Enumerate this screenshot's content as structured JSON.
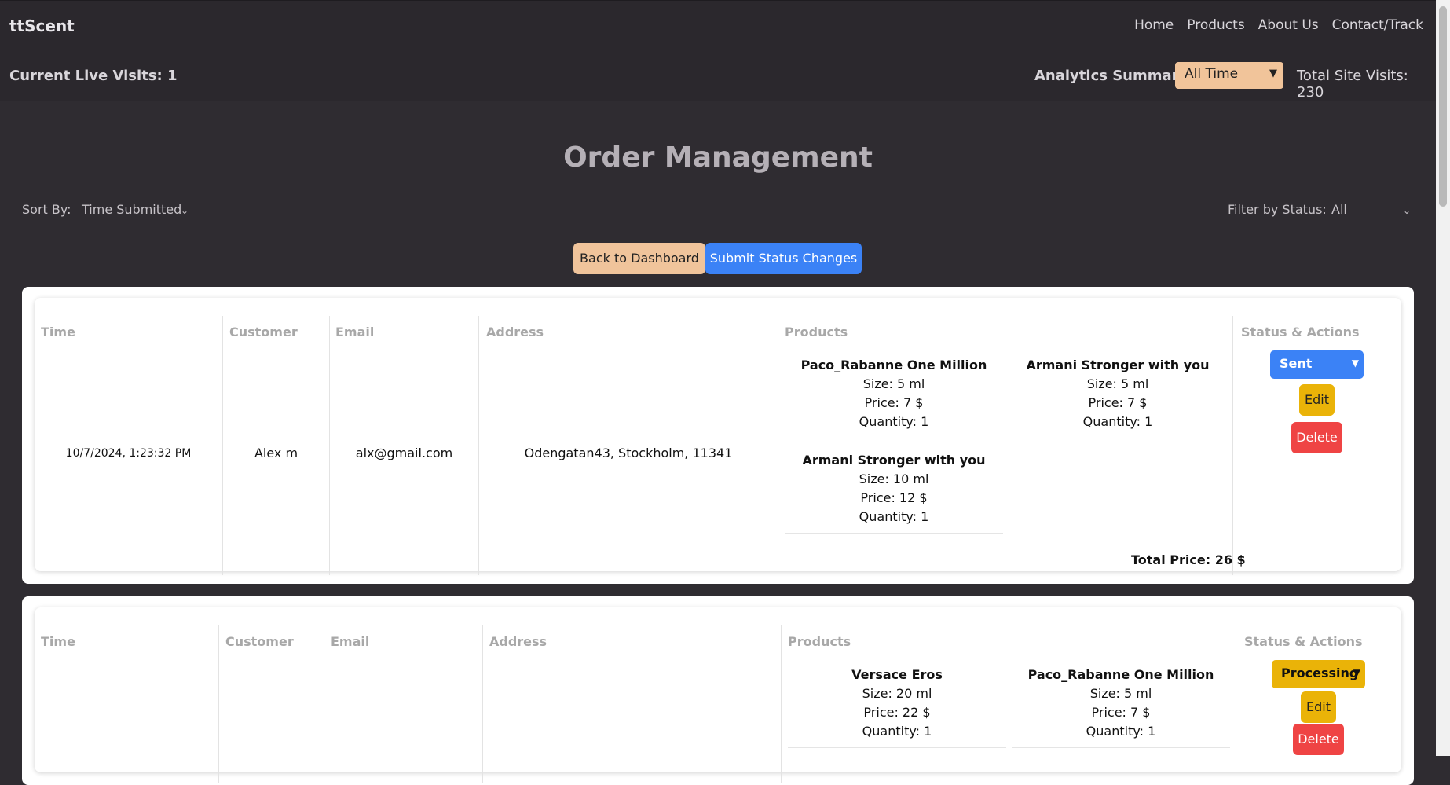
{
  "header": {
    "brand": "ttScent",
    "nav": [
      "Home",
      "Products",
      "About Us",
      "Contact/Track"
    ],
    "live_visits": "Current Live Visits: 1",
    "analytics_label": "Analytics Summary",
    "range_selected": "All Time",
    "total_visits": "Total Site Visits: 230"
  },
  "page": {
    "title": "Order Management",
    "sort_label": "Sort By:",
    "sort_value": "Time Submitted",
    "filter_label": "Filter by Status:",
    "filter_value": "All",
    "back_button": "Back to Dashboard",
    "submit_button": "Submit Status Changes"
  },
  "columns": [
    "Time",
    "Customer",
    "Email",
    "Address",
    "Products",
    "Status & Actions"
  ],
  "orders": [
    {
      "time": "10/7/2024, 1:23:32 PM",
      "customer": "Alex m",
      "email": "alx@gmail.com",
      "address": "Odengatan43, Stockholm, 11341",
      "products": [
        {
          "name": "Paco_Rabanne One Million",
          "size": "Size: 5 ml",
          "price": "Price: 7 $",
          "quantity": "Quantity: 1"
        },
        {
          "name": "Armani Stronger with you",
          "size": "Size: 5 ml",
          "price": "Price: 7 $",
          "quantity": "Quantity: 1"
        },
        {
          "name": "Armani Stronger with you",
          "size": "Size: 10 ml",
          "price": "Price: 12 $",
          "quantity": "Quantity: 1"
        }
      ],
      "total": "Total Price: 26 $",
      "status": "Sent",
      "status_color": "#3b82f6",
      "edit_label": "Edit",
      "delete_label": "Delete"
    },
    {
      "products": [
        {
          "name": "Versace Eros",
          "size": "Size: 20 ml",
          "price": "Price: 22 $",
          "quantity": "Quantity: 1"
        },
        {
          "name": "Paco_Rabanne One Million",
          "size": "Size: 5 ml",
          "price": "Price: 7 $",
          "quantity": "Quantity: 1"
        }
      ],
      "status": "Processing",
      "status_color": "#eab308",
      "edit_label": "Edit",
      "delete_label": "Delete"
    }
  ],
  "colors": {
    "background": "#2f2c31",
    "accent_peach": "#f0c49b",
    "accent_blue": "#3b82f6",
    "edit_yellow": "#eab308",
    "delete_red": "#ef4444"
  }
}
